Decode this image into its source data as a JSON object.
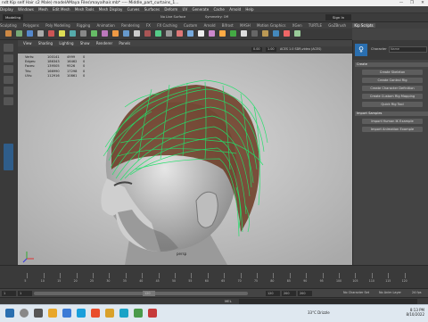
{
  "window": {
    "title": "ndt Kip self Hair c2 Male) modelAMaya Files\\mayalhair.mb* ---- Middle_part_curtains_1...",
    "controls": [
      "—",
      "❐",
      "✕"
    ]
  },
  "menubar": {
    "items": [
      "Display",
      "Windows",
      "Mesh",
      "Edit Mesh",
      "Mesh Tools",
      "Mesh Display",
      "Curves",
      "Surfaces",
      "Deform",
      "UV",
      "Generate",
      "Cache",
      "Arnold",
      "Help"
    ],
    "mode": "Modeling",
    "symmetry": "Symmetry: Off",
    "no_live": "No Live Surface",
    "signin": "Sign In"
  },
  "shelf_tabs": {
    "items": [
      "Sculpting",
      "Polygons",
      "Poly Modeling",
      "Rigging",
      "Animation",
      "Rendering",
      "FX",
      "FX Caching",
      "Custom",
      "Arnold",
      "Bifrost",
      "MASH",
      "Motion Graphics",
      "XGen",
      "TURTLE",
      "GoZBrush",
      "Kip Scripts"
    ],
    "active": "Kip Scripts"
  },
  "viewport": {
    "menu": [
      "View",
      "Shading",
      "Lighting",
      "Show",
      "Renderer",
      "Panels"
    ],
    "exposure": "0.00",
    "gamma": "1.00",
    "colorspace": "ACES 1.0 SDR-video (ACES)",
    "hud": {
      "headers": [
        "",
        "",
        ""
      ],
      "rows": [
        {
          "label": "Verts:",
          "a": "100141",
          "b": "4999",
          "c": "0"
        },
        {
          "label": "Edges:",
          "a": "186343",
          "b": "16462",
          "c": "0"
        },
        {
          "label": "Faces:",
          "a": "139505",
          "b": "9526",
          "c": "0"
        },
        {
          "label": "Tris:",
          "a": "166990",
          "b": "17298",
          "c": "0"
        },
        {
          "label": "UVs:",
          "a": "112916",
          "b": "10861",
          "c": "0"
        }
      ]
    },
    "camera_label": "persp"
  },
  "right_panel": {
    "field_label": "Character",
    "field_value": "Name",
    "sections": [
      {
        "title": "Create",
        "buttons": [
          "Create Skeleton",
          "Create Control Rig",
          "Create Character Definition",
          "Create Custom Rig Mapping",
          "Quick Rig Tool"
        ]
      },
      {
        "title": "Import Samples",
        "buttons": [
          "Import Human IK Example",
          "Import Animation Example"
        ]
      }
    ]
  },
  "timeline": {
    "ticks": [
      "5",
      "10",
      "15",
      "20",
      "25",
      "30",
      "35",
      "40",
      "45",
      "50",
      "55",
      "60",
      "65",
      "70",
      "75",
      "80",
      "85",
      "90",
      "95",
      "100",
      "105",
      "110",
      "115",
      "120"
    ]
  },
  "range": {
    "start": "1",
    "start2": "1",
    "end": "120",
    "end2": "120",
    "end3": "200",
    "end4": "200",
    "char_set": "No Character Set",
    "anim_layer": "No Anim Layer",
    "fps": "24 fps"
  },
  "cmdline": {
    "label": "MEL"
  },
  "taskbar": {
    "temperature": "33°C  Drizzle",
    "time": "8:13 PM",
    "date": "8/10/2022"
  }
}
